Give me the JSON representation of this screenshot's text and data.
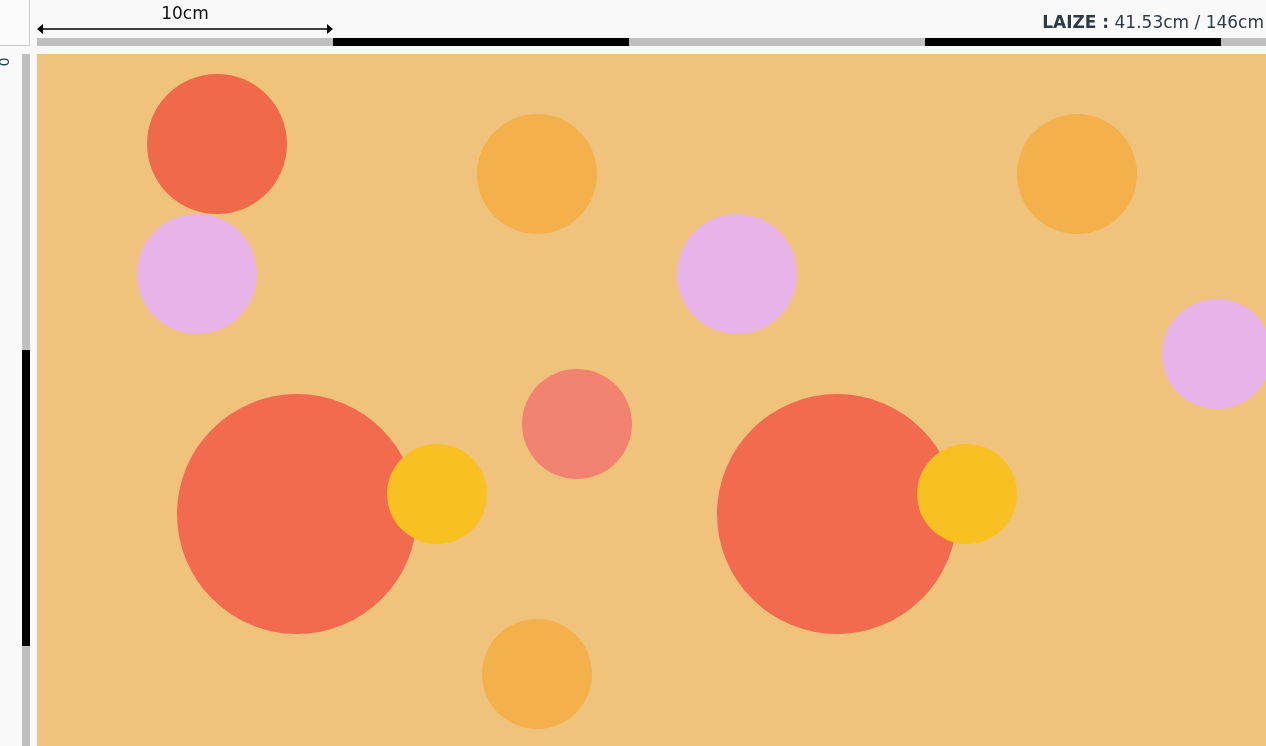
{
  "top_ruler": {
    "scale_label": "10cm",
    "width_label": "LAIZE :",
    "width_value": "41.53cm / 146cm"
  },
  "left_ruler": {
    "scale_label": "0"
  }
}
